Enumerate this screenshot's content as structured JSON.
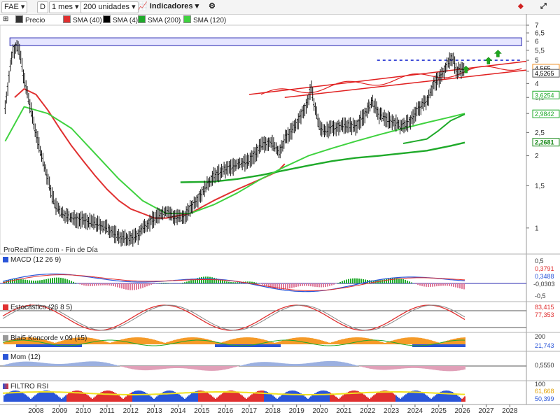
{
  "toolbar": {
    "symbol": "FAE",
    "period_badge": "D",
    "timeframe": "1 mes",
    "units": "200 unidades",
    "indicators_label": "Indicadores"
  },
  "legend": {
    "price": "Precio",
    "sma40": "SMA (40)",
    "sma4": "SMA (4)",
    "sma200": "SMA (200)",
    "sma120": "SMA (120)"
  },
  "watermark": "ProRealTime.com - Fin de Día",
  "panels": {
    "macd": "MACD (12 26 9)",
    "stoch": "Estocástico (26 8 5)",
    "konc": "Blai5 Koncorde v.09 (15)",
    "mom": "Mom (12)",
    "rsi": "FILTRO RSI"
  },
  "colors": {
    "price": "#111111",
    "sma40": "#e03030",
    "sma4": "#000000",
    "sma200": "#1faa2a",
    "sma120": "#3fd23f",
    "channel": "#e02020",
    "resistance": "#1f2fd0",
    "zone_fill": "#e6e6ff",
    "zone_border": "#2a2ab0",
    "arrow": "#1ea81e",
    "konc_orange": "#f59a28",
    "konc_blue": "#2a55d8"
  },
  "chart_data": {
    "type": "line",
    "title": "FAE",
    "y_scale": "log",
    "ylim": [
      0.85,
      7.0
    ],
    "yticks": [
      "7",
      "6,5",
      "6",
      "5,5",
      "5",
      "4,5",
      "4",
      "3,5",
      "3",
      "2,5",
      "2",
      "1,5",
      "1"
    ],
    "xlim": [
      2007.1,
      2029.2
    ],
    "xticks": [
      "2008",
      "2009",
      "2010",
      "2011",
      "2012",
      "2013",
      "2014",
      "2015",
      "2016",
      "2017",
      "2018",
      "2019",
      "2020",
      "2021",
      "2022",
      "2023",
      "2024",
      "2025",
      "2026",
      "2027",
      "2028"
    ],
    "price_tags": {
      "sma4": "4,565",
      "price": "4,5265",
      "sma40": "3,6254",
      "sma120": "2,9842",
      "sma200": "2,2681"
    },
    "series": [
      {
        "name": "Precio",
        "x": [
          2007.2,
          2007.5,
          2007.7,
          2007.85,
          2008.0,
          2008.2,
          2008.5,
          2008.8,
          2009.0,
          2009.3,
          2009.6,
          2010.0,
          2010.5,
          2011.0,
          2011.5,
          2012.0,
          2012.4,
          2012.8,
          2013.0,
          2013.5,
          2014.0,
          2014.3,
          2014.7,
          2015.0,
          2015.5,
          2016.0,
          2016.5,
          2017.0,
          2017.5,
          2018.0,
          2018.4,
          2018.8,
          2019.0,
          2019.5,
          2020.0,
          2020.1,
          2020.3,
          2020.5,
          2020.8,
          2021.0,
          2021.5,
          2022.0,
          2022.5,
          2022.7,
          2023.0,
          2023.5,
          2024.0,
          2024.3,
          2024.7,
          2025.0,
          2025.3,
          2025.6,
          2025.9,
          2026.1,
          2026.25,
          2026.4,
          2026.6
        ],
        "y": [
          3.2,
          5.4,
          5.8,
          5.2,
          4.2,
          3.4,
          2.5,
          1.9,
          1.6,
          1.25,
          1.15,
          1.1,
          1.08,
          1.05,
          1.0,
          0.92,
          0.9,
          0.93,
          1.0,
          1.1,
          1.18,
          1.12,
          1.1,
          1.2,
          1.4,
          1.65,
          1.75,
          1.85,
          1.9,
          2.2,
          2.3,
          2.05,
          2.35,
          2.7,
          3.4,
          3.9,
          3.1,
          2.6,
          2.55,
          2.6,
          2.7,
          2.65,
          3.1,
          3.35,
          2.95,
          2.8,
          2.65,
          2.8,
          3.2,
          3.4,
          4.0,
          4.3,
          4.9,
          5.15,
          4.5,
          4.6,
          4.5
        ]
      },
      {
        "name": "SMA (40)",
        "x": [
          2007.6,
          2008.0,
          2008.5,
          2009.0,
          2009.5,
          2010.0,
          2010.5,
          2011.0,
          2011.5,
          2012.0,
          2012.5,
          2013.0,
          2013.5,
          2014.0,
          2015.0,
          2016.0,
          2017.0,
          2018.0,
          2018.7,
          2019.0
        ],
        "y": [
          3.5,
          3.8,
          3.6,
          3.1,
          2.6,
          2.2,
          1.9,
          1.65,
          1.45,
          1.3,
          1.2,
          1.15,
          1.1,
          1.1,
          1.15,
          1.3,
          1.45,
          1.6,
          1.72,
          1.85
        ]
      },
      {
        "name": "SMA (200)",
        "x": [
          2014.6,
          2016.0,
          2017.0,
          2018.0,
          2019.0,
          2020.0,
          2021.0,
          2022.0,
          2023.0,
          2024.0,
          2025.0,
          2026.0,
          2026.6
        ],
        "y": [
          1.55,
          1.56,
          1.6,
          1.66,
          1.74,
          1.82,
          1.9,
          1.96,
          2.0,
          2.05,
          2.1,
          2.2,
          2.27
        ]
      },
      {
        "name": "SMA (120)",
        "x": [
          2007.2,
          2008.0,
          2009.0,
          2010.0,
          2012.0,
          2013.0,
          2014.0,
          2015.0,
          2016.0,
          2017.0,
          2018.0,
          2019.0,
          2020.0,
          2021.0,
          2022.0,
          2023.0,
          2024.0,
          2025.0,
          2026.0,
          2026.6
        ],
        "y": [
          2.3,
          3.2,
          3.0,
          2.6,
          1.6,
          1.3,
          1.15,
          1.15,
          1.25,
          1.4,
          1.6,
          1.8,
          2.0,
          2.15,
          2.3,
          2.45,
          2.6,
          2.75,
          2.9,
          3.0
        ]
      },
      {
        "name": "SMA (200) mid",
        "x": [
          2024.0,
          2024.5,
          2025.0,
          2025.5,
          2026.0,
          2026.6
        ],
        "y": [
          2.25,
          2.3,
          2.35,
          2.55,
          2.8,
          2.98
        ]
      }
    ],
    "annotations": {
      "resistance_level": 5.0,
      "zone": [
        5.75,
        6.2
      ]
    }
  }
}
